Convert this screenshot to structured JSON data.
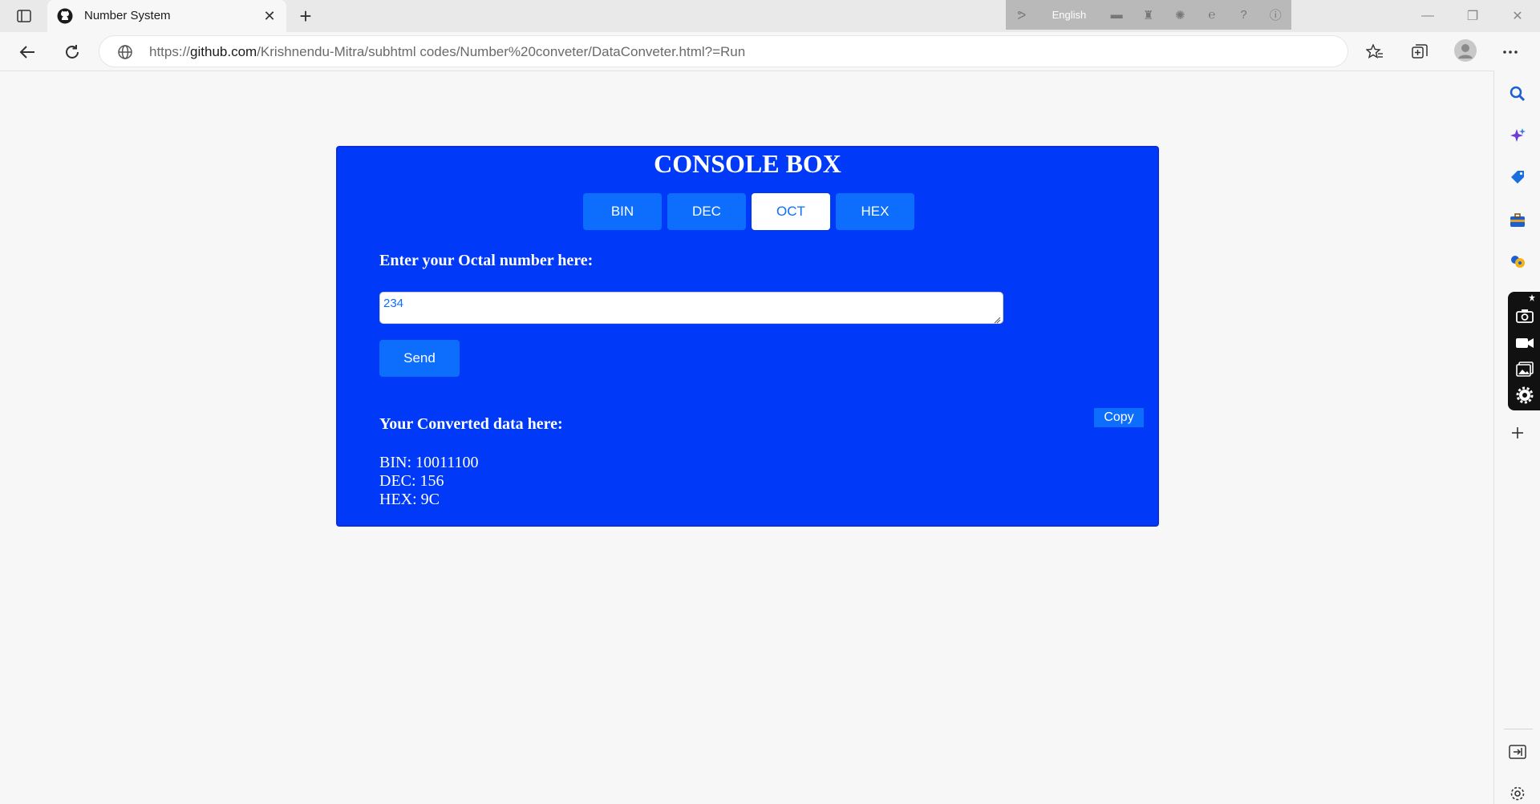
{
  "browser": {
    "tab": {
      "title": "Number System"
    },
    "address": {
      "prefix": "https://",
      "host": "github.com",
      "path": "/Krishnendu-Mitra/subhtml codes/Number%20conveter/DataConveter.html?=Run"
    },
    "ime": {
      "language": "English"
    }
  },
  "console": {
    "title": "CONSOLE BOX",
    "tabs": [
      {
        "label": "BIN",
        "active": false
      },
      {
        "label": "DEC",
        "active": false
      },
      {
        "label": "OCT",
        "active": true
      },
      {
        "label": "HEX",
        "active": false
      }
    ],
    "prompt": "Enter your Octal number here:",
    "input_value": "234",
    "send_label": "Send",
    "copy_label": "Copy",
    "result_title": "Your Converted data here:",
    "results": [
      "BIN: 10011100",
      "DEC: 156",
      "HEX: 9C"
    ]
  },
  "colors": {
    "console_bg": "#0039f7",
    "button_blue": "#0d6efd",
    "page_bg": "#f7f7f7"
  }
}
